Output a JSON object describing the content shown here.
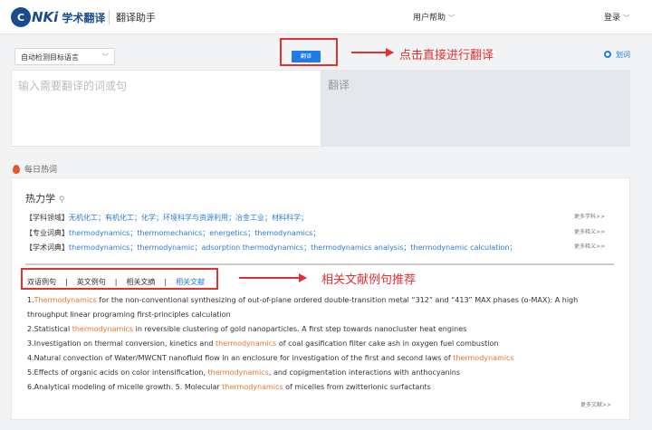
{
  "header": {
    "logo_badge": "C",
    "logo_brand": "NKi",
    "logo_text": "学术翻译",
    "subtitle": "翻译助手",
    "help_label": "用户帮助",
    "login_label": "登录"
  },
  "toolbar": {
    "language_select": "自动检测目标语言",
    "translate_button": "翻译",
    "huaci_label": "划词",
    "annotation_translate": "点击直接进行翻译"
  },
  "input": {
    "placeholder": "输入需要翻译的词或句",
    "output_placeholder": "翻译"
  },
  "hot": {
    "section_title": "每日热词",
    "term": "热力学",
    "rows": [
      {
        "label": "【学科领域】",
        "links": "无机化工；有机化工；化学；环境科学与资源利用；冶金工业；材料科学；",
        "more": "更多学科>>"
      },
      {
        "label": "【专业词典】",
        "links": "thermodynamics；thermomechanics；energetics；themodynamics；",
        "more": "更多释义>>"
      },
      {
        "label": "【学术词典】",
        "links": "thermodynamics；thermodynamic；adsorption thermodynamics；thermodynamics analysis；thermodynamic calculation；",
        "more": "更多释义>>"
      }
    ]
  },
  "tabs": {
    "items": [
      "双语例句",
      "英文例句",
      "相关文摘",
      "相关文献"
    ],
    "separator": "|",
    "active_index": 3,
    "annotation": "相关文献例句推荐"
  },
  "examples": [
    {
      "pre": "1.",
      "hl": "Thermodynamics",
      "post": " for the non-conventional synthesizing of out-of-plane ordered double-transition metal  “312”  and  “413”  MAX phases (o-MAX): A high throughput linear programing first-principles calculation"
    },
    {
      "pre": "2.Statistical ",
      "hl": "thermodynamics",
      "post": " in reversible clustering of gold nanoparticles. A first step towards nanocluster heat engines"
    },
    {
      "pre": "3.Investigation on thermal conversion, kinetics and ",
      "hl": "thermodynamics",
      "post": " of coal gasification filter cake ash in oxygen fuel combustion"
    },
    {
      "pre": "4.Natural convection of Water/MWCNT nanofluid flow in an enclosure for investigation of the first and second laws of ",
      "hl": "thermodynamics",
      "post": ""
    },
    {
      "pre": "5.Effects of organic acids on color intensification, ",
      "hl": "thermodynamics",
      "post": ", and copigmentation interactions with anthocyanins"
    },
    {
      "pre": "6.Analytical modeling of micelle growth. 5. Molecular ",
      "hl": "thermodynamics",
      "post": " of micelles from zwitterionic surfactants"
    }
  ],
  "more_docs": "更多文献>>"
}
